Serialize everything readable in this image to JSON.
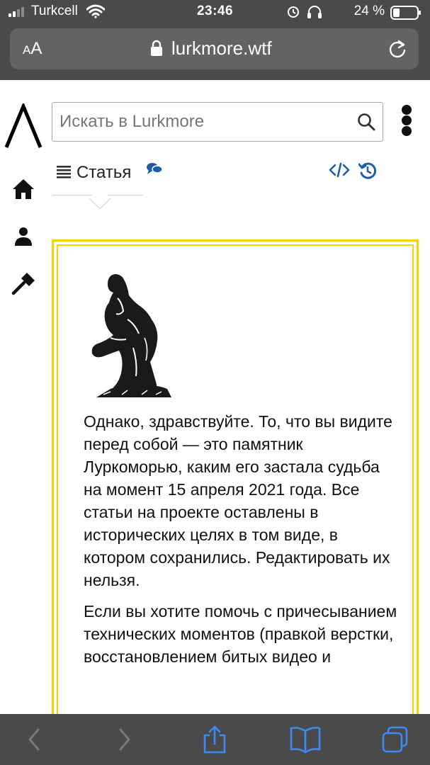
{
  "status_bar": {
    "carrier": "Turkcell",
    "time": "23:46",
    "battery_percent": "24 %"
  },
  "browser": {
    "text_size_button": {
      "small": "A",
      "large": "A"
    },
    "url": "lurkmore.wtf"
  },
  "site": {
    "logo": "Λ",
    "search": {
      "placeholder": "Искать в Lurkmore"
    }
  },
  "tabs": {
    "article_label": "Статья"
  },
  "notice": {
    "paragraphs": [
      "Однако, здравствуйте. То, что вы видите перед собой — это памятник Луркоморью, каким его застала судьба на момент 15 апреля 2021 года. Все статьи на проекте оставлены в исторических целях в том виде, в котором сохранились. Редактировать их нельзя.",
      "Если вы хотите помочь с причесыванием технических моментов (правкой верстки, восстановлением битых видео и"
    ]
  },
  "colors": {
    "chrome_bg": "#4a4a4a",
    "address_bg": "#636363",
    "link_blue": "#1e5ea8",
    "notice_border": "#f2d600",
    "toolbar_icon": "#3d8af7"
  }
}
